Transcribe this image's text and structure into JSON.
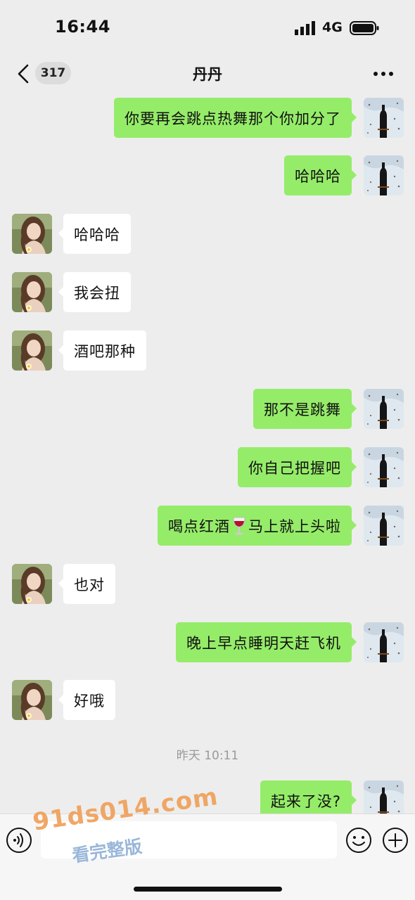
{
  "status_bar": {
    "time": "16:44",
    "network": "4G"
  },
  "nav": {
    "badge": "317",
    "title": "丹丹"
  },
  "messages": [
    {
      "side": "out",
      "text": "你要再会跳点热舞那个你加分了"
    },
    {
      "side": "out",
      "text": "哈哈哈"
    },
    {
      "side": "in",
      "text": "哈哈哈"
    },
    {
      "side": "in",
      "text": "我会扭"
    },
    {
      "side": "in",
      "text": "酒吧那种"
    },
    {
      "side": "out",
      "text": "那不是跳舞"
    },
    {
      "side": "out",
      "text": "你自己把握吧"
    },
    {
      "side": "out",
      "text_before": "喝点红酒",
      "emoji": "wine-glass",
      "text_after": "马上就上头啦"
    },
    {
      "side": "in",
      "text": "也对"
    },
    {
      "side": "out",
      "text": "晚上早点睡明天赶飞机"
    },
    {
      "side": "in",
      "text": "好哦"
    },
    {
      "side": "out",
      "text": "起来了没?"
    }
  ],
  "timestamp": "昨天 10:11",
  "watermark": {
    "url": "91ds014.com",
    "subtitle": "看完整版"
  },
  "colors": {
    "background": "#ededed",
    "outgoing_bubble": "#95ec69",
    "incoming_bubble": "#ffffff",
    "timestamp": "#9a9a9a"
  }
}
